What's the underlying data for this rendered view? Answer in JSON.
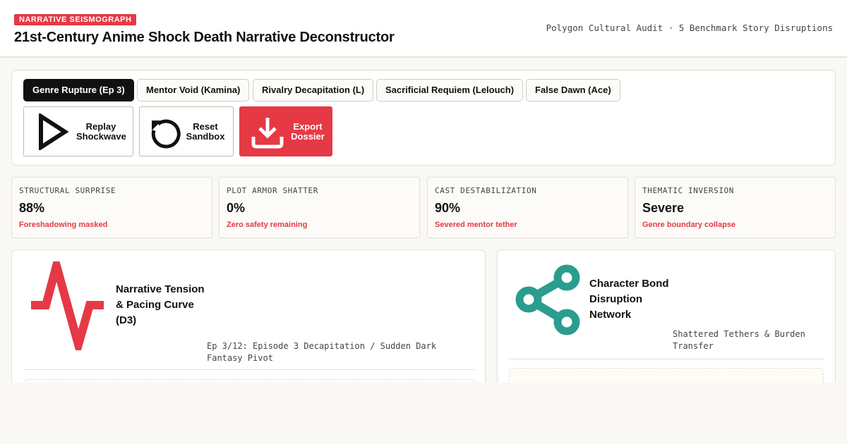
{
  "header": {
    "badge": "NARRATIVE SEISMOGRAPH",
    "title": "21st-Century Anime Shock Death Narrative Deconstructor",
    "subtitle": "Polygon Cultural Audit · 5 Benchmark Story Disruptions"
  },
  "tabs": [
    {
      "label": "Genre Rupture (Ep 3)",
      "active": true
    },
    {
      "label": "Mentor Void (Kamina)",
      "active": false
    },
    {
      "label": "Rivalry Decapitation (L)",
      "active": false
    },
    {
      "label": "Sacrificial Requiem (Lelouch)",
      "active": false
    },
    {
      "label": "False Dawn (Ace)",
      "active": false
    }
  ],
  "actions": {
    "replay": {
      "label": "Replay\nShockwave",
      "icon": "play-icon"
    },
    "reset": {
      "label": "Reset\nSandbox",
      "icon": "reset-icon"
    },
    "export": {
      "label": "Export\nDossier",
      "icon": "download-icon"
    }
  },
  "stats": [
    {
      "key": "STRUCTURAL SURPRISE",
      "value": "88%",
      "note": "Foreshadowing masked"
    },
    {
      "key": "PLOT ARMOR SHATTER",
      "value": "0%",
      "note": "Zero safety remaining"
    },
    {
      "key": "CAST DESTABILIZATION",
      "value": "90%",
      "note": "Severed mentor tether"
    },
    {
      "key": "THEMATIC INVERSION",
      "value": "Severe",
      "note": "Genre boundary collapse"
    }
  ],
  "cards": {
    "tension": {
      "title": "Narrative Tension\n& Pacing Curve\n(D3)",
      "meta": "Ep 3/12: Episode 3 Decapitation / Sudden Dark\nFantasy Pivot",
      "icon": "pulse-icon"
    },
    "network": {
      "title": "Character Bond\nDisruption\nNetwork",
      "meta": "Shattered Tethers & Burden\nTransfer",
      "icon": "share-network-icon"
    }
  },
  "colors": {
    "accent": "#e53945",
    "teal": "#2a9d8f",
    "ink": "#111111"
  }
}
